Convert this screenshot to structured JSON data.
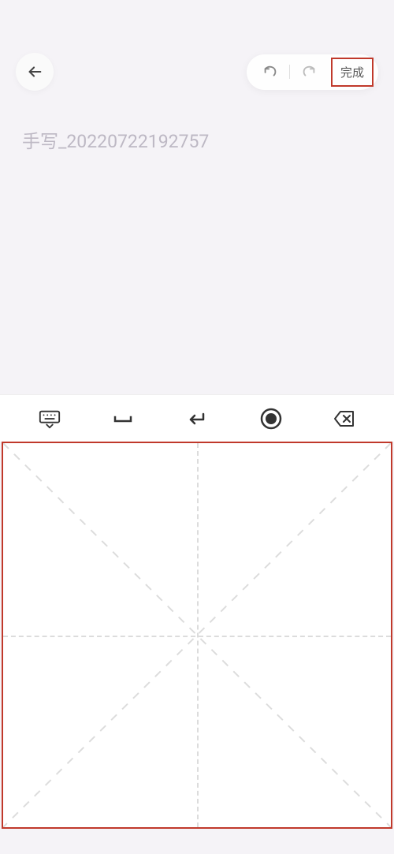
{
  "header": {
    "done_label": "完成"
  },
  "title": {
    "placeholder": "手写_20220722192757"
  },
  "icons": {
    "back": "arrow-left",
    "undo": "undo",
    "redo": "redo",
    "keyboard": "keyboard",
    "space": "space",
    "enter": "enter",
    "record": "record",
    "backspace": "backspace"
  }
}
